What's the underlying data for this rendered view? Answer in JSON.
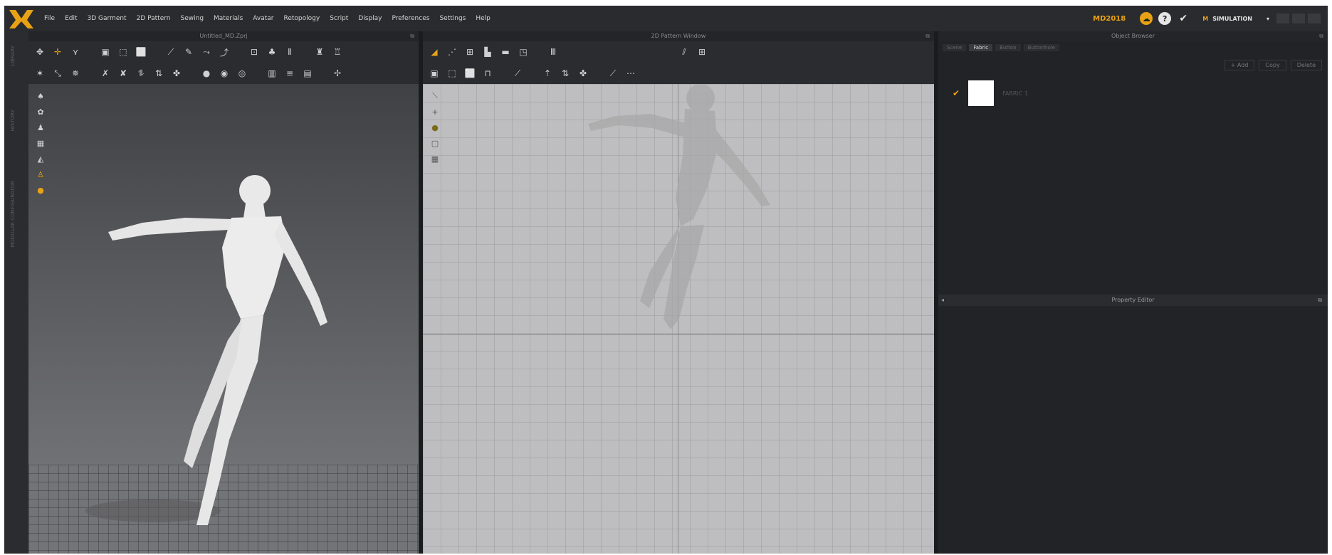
{
  "menubar": {
    "items": [
      "File",
      "Edit",
      "3D Garment",
      "2D Pattern",
      "Sewing",
      "Materials",
      "Avatar",
      "Retopology",
      "Script",
      "Display",
      "Preferences",
      "Settings",
      "Help"
    ],
    "brand": "MD2018",
    "mode_label": "SIMULATION",
    "accent_color": "#e8a215"
  },
  "viewport3d": {
    "title": "Untitled_MD.Zprj"
  },
  "viewport2d": {
    "title": "2D Pattern Window"
  },
  "object_browser": {
    "title": "Object Browser",
    "tabs": [
      "Scene",
      "Fabric",
      "Button",
      "Buttonhole"
    ],
    "active_tab": "Fabric",
    "buttons": [
      "+ Add",
      "Copy",
      "Delete"
    ],
    "fabric_item": "FABRIC 1"
  },
  "property_editor": {
    "title": "Property Editor"
  }
}
